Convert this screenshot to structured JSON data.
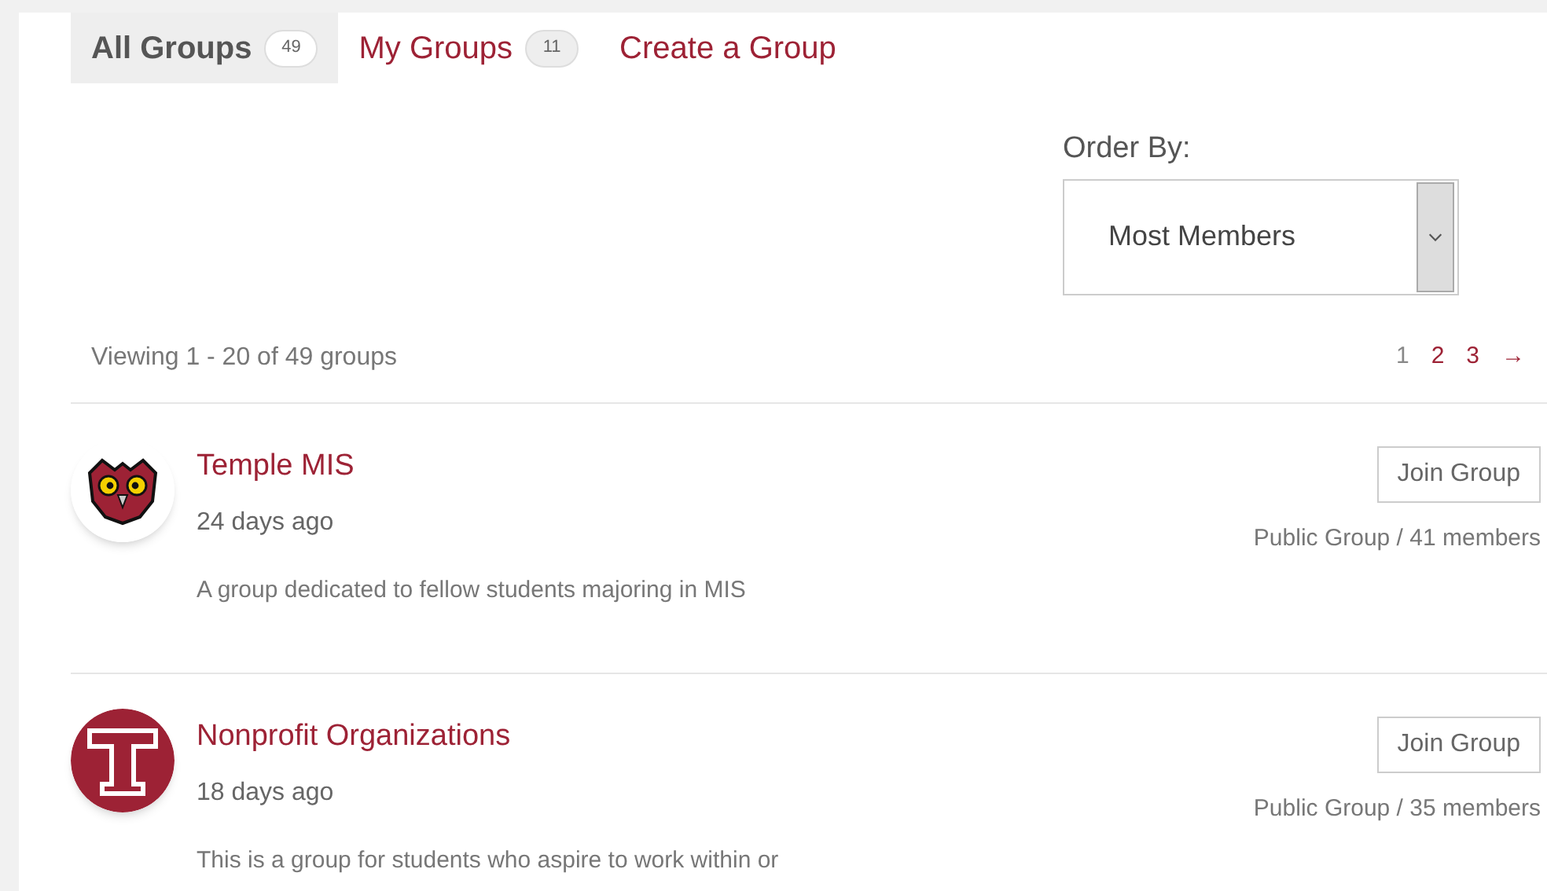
{
  "tabs": [
    {
      "label": "All Groups",
      "count": "49",
      "selected": true
    },
    {
      "label": "My Groups",
      "count": "11",
      "selected": false
    },
    {
      "label": "Create a Group",
      "selected": false
    }
  ],
  "order_by": {
    "label": "Order By:",
    "value": "Most Members"
  },
  "viewing": "Viewing 1 - 20 of 49 groups",
  "pagination": [
    {
      "label": "1",
      "selected": true
    },
    {
      "label": "2",
      "selected": false
    },
    {
      "label": "3",
      "selected": false
    },
    {
      "label": "→",
      "selected": false
    }
  ],
  "groups": [
    {
      "name": "Temple MIS",
      "kind": "owl",
      "time": "24 days ago",
      "description": "A group dedicated to fellow students majoring in MIS",
      "button": "Join Group",
      "meta": "Public Group / 41 members"
    },
    {
      "name": "Nonprofit Organizations",
      "kind": "letter",
      "time": "18 days ago",
      "description": "This is a group for students who aspire to work within or",
      "button": "Join Group",
      "meta": "Public Group / 35 members"
    }
  ]
}
